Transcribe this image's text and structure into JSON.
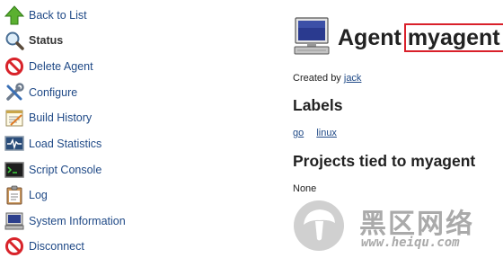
{
  "sidebar": {
    "items": [
      {
        "label": "Back to List",
        "icon": "up-arrow-icon",
        "active": false
      },
      {
        "label": "Status",
        "icon": "magnifier-icon",
        "active": true
      },
      {
        "label": "Delete Agent",
        "icon": "no-entry-icon",
        "active": false
      },
      {
        "label": "Configure",
        "icon": "tools-icon",
        "active": false
      },
      {
        "label": "Build History",
        "icon": "notepad-icon",
        "active": false
      },
      {
        "label": "Load Statistics",
        "icon": "monitor-graph-icon",
        "active": false
      },
      {
        "label": "Script Console",
        "icon": "terminal-icon",
        "active": false
      },
      {
        "label": "Log",
        "icon": "clipboard-icon",
        "active": false
      },
      {
        "label": "System Information",
        "icon": "computer-icon",
        "active": false
      },
      {
        "label": "Disconnect",
        "icon": "no-entry-icon",
        "active": false
      }
    ]
  },
  "main": {
    "title_prefix": "Agent",
    "agent_name": "myagent",
    "created_prefix": "Created by",
    "created_by": "jack",
    "labels_heading": "Labels",
    "labels": [
      "go",
      "linux"
    ],
    "projects_heading": "Projects tied to myagent",
    "projects_empty": "None"
  },
  "watermark": {
    "cn_text": "黑区网络",
    "url": "www.heiqu.com"
  },
  "colors": {
    "link": "#204a87",
    "highlight_border": "#d9202a",
    "text": "#222222"
  }
}
